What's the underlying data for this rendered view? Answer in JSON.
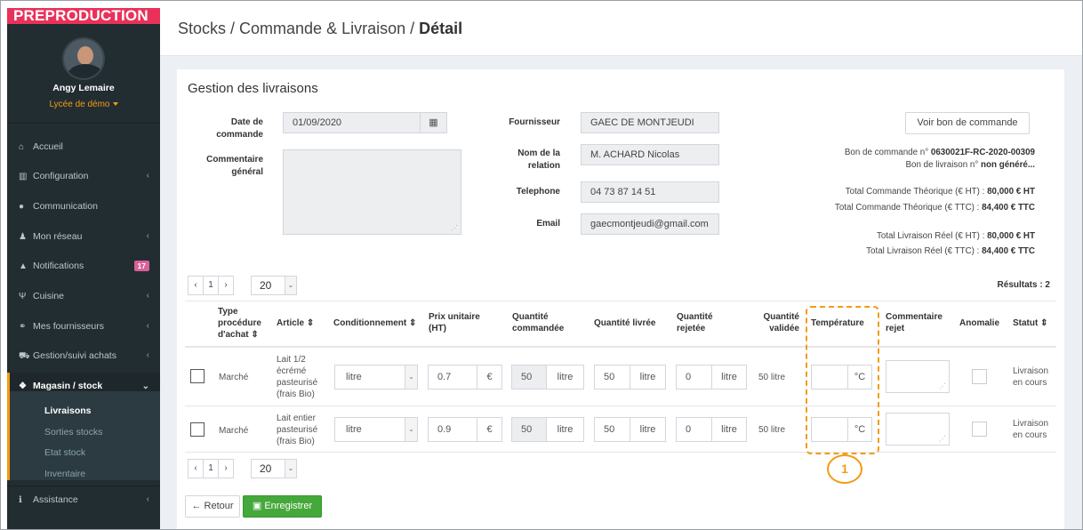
{
  "env_badge": "PREPRODUCTION",
  "user": {
    "name": "Angy Lemaire",
    "school": "Lycée de démo"
  },
  "nav": {
    "accueil": "Accueil",
    "configuration": "Configuration",
    "communication": "Communication",
    "reseau": "Mon réseau",
    "notifications": "Notifications",
    "notifications_count": "17",
    "cuisine": "Cuisine",
    "fournisseurs": "Mes fournisseurs",
    "achats": "Gestion/suivi achats",
    "magasin": "Magasin / stock",
    "sub": {
      "livraisons": "Livraisons",
      "sorties": "Sorties stocks",
      "etat": "Etat stock",
      "inventaire": "Inventaire"
    },
    "assistance": "Assistance"
  },
  "breadcrumb": {
    "part1": "Stocks / Commande & Livraison / ",
    "current": "Détail"
  },
  "panel_title": "Gestion des livraisons",
  "form": {
    "date_label_1": "Date de",
    "date_label_2": "commande",
    "date_value": "01/09/2020",
    "comment_label_1": "Commentaire",
    "comment_label_2": "général",
    "fournisseur_label": "Fournisseur",
    "fournisseur_value": "GAEC DE MONTJEUDI",
    "relation_label_1": "Nom de la",
    "relation_label_2": "relation",
    "relation_value": "M. ACHARD Nicolas",
    "tel_label": "Telephone",
    "tel_value": "04 73 87 14 51",
    "email_label": "Email",
    "email_value": "gaecmontjeudi@gmail.com"
  },
  "voir_btn": "Voir bon de commande",
  "info": {
    "bc_label": "Bon de commande n° ",
    "bc_value": "0630021F-RC-2020-00309",
    "bl_label": "Bon de livraison n° ",
    "bl_value": "non généré...",
    "tct_ht_label": "Total Commande Théorique (€ HT) : ",
    "tct_ht_value": "80,000 € HT",
    "tct_ttc_label": "Total Commande Théorique (€ TTC) : ",
    "tct_ttc_value": "84,400 € TTC",
    "tlr_ht_label": "Total Livraison Réel (€ HT) : ",
    "tlr_ht_value": "80,000 € HT",
    "tlr_ttc_label": "Total Livraison Réel (€ TTC) : ",
    "tlr_ttc_value": "84,400 € TTC"
  },
  "pager": {
    "prev": "‹",
    "page": "1",
    "next": "›",
    "page_size": "20"
  },
  "results": "Résultats : 2",
  "columns": {
    "type_1": "Type",
    "type_2": "procédure",
    "type_3": "d'achat ⇕",
    "article": "Article ⇕",
    "cond": "Conditionnement ⇕",
    "prix_1": "Prix unitaire",
    "prix_2": "(HT)",
    "qc_1": "Quantité",
    "qc_2": "commandée",
    "ql": "Quantité livrée",
    "qr_1": "Quantité",
    "qr_2": "rejetée",
    "qv_1": "Quantité",
    "qv_2": "validée",
    "temp": "Température",
    "com_1": "Commentaire",
    "com_2": "rejet",
    "anomalie": "Anomalie",
    "statut": "Statut ⇕"
  },
  "rows": [
    {
      "type": "Marché",
      "article_1": "Lait 1/2",
      "article_2": "écrémé",
      "article_3": "pasteurisé",
      "article_4": "(frais Bio)",
      "cond": "litre",
      "prix": "0.7",
      "currency": "€",
      "qc": "50",
      "qc_unit": "litre",
      "ql": "50",
      "ql_unit": "litre",
      "qr": "0",
      "qr_unit": "litre",
      "qv": "50 litre",
      "temp_unit": "°C",
      "statut_1": "Livraison",
      "statut_2": "en cours"
    },
    {
      "type": "Marché",
      "article_1": "Lait entier",
      "article_2": "pasteurisé",
      "article_3": "(frais Bio)",
      "cond": "litre",
      "prix": "0.9",
      "currency": "€",
      "qc": "50",
      "qc_unit": "litre",
      "ql": "50",
      "ql_unit": "litre",
      "qr": "0",
      "qr_unit": "litre",
      "qv": "50 litre",
      "temp_unit": "°C",
      "statut_1": "Livraison",
      "statut_2": "en cours"
    }
  ],
  "buttons": {
    "retour": "Retour",
    "retour_icon": "←",
    "enregistrer": "Enregistrer"
  },
  "annotation": "1",
  "colors": {
    "accent": "#f39c12",
    "sidebar": "#222d32",
    "save": "#45a83a",
    "badge": "#e8325a"
  }
}
